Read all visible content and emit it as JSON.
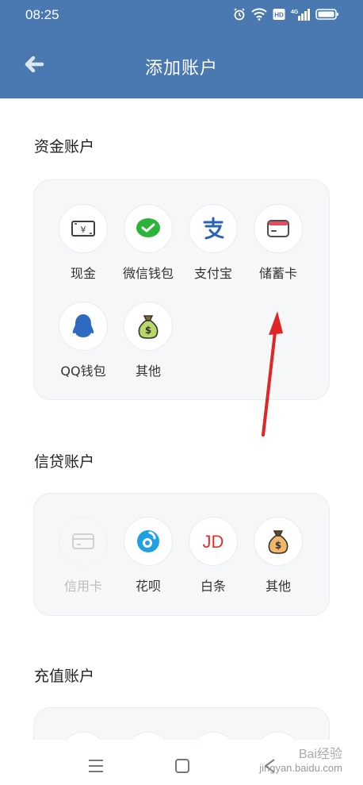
{
  "status": {
    "time": "08:25",
    "network": "4G"
  },
  "header": {
    "title": "添加账户"
  },
  "sections": [
    {
      "title": "资金账户",
      "items": [
        {
          "label": "现金",
          "icon": "cash-icon"
        },
        {
          "label": "微信钱包",
          "icon": "wechat-icon"
        },
        {
          "label": "支付宝",
          "icon": "alipay-icon"
        },
        {
          "label": "储蓄卡",
          "icon": "savings-card-icon"
        },
        {
          "label": "QQ钱包",
          "icon": "qq-icon"
        },
        {
          "label": "其他",
          "icon": "money-bag-icon"
        }
      ]
    },
    {
      "title": "信贷账户",
      "items": [
        {
          "label": "信用卡",
          "icon": "credit-card-icon",
          "disabled": true
        },
        {
          "label": "花呗",
          "icon": "huabei-icon"
        },
        {
          "label": "白条",
          "icon": "jd-icon"
        },
        {
          "label": "其他",
          "icon": "money-bag-icon"
        }
      ]
    },
    {
      "title": "充值账户"
    }
  ],
  "watermark": {
    "line1": "Bai经验",
    "line2": "jingyan.baidu.com"
  }
}
